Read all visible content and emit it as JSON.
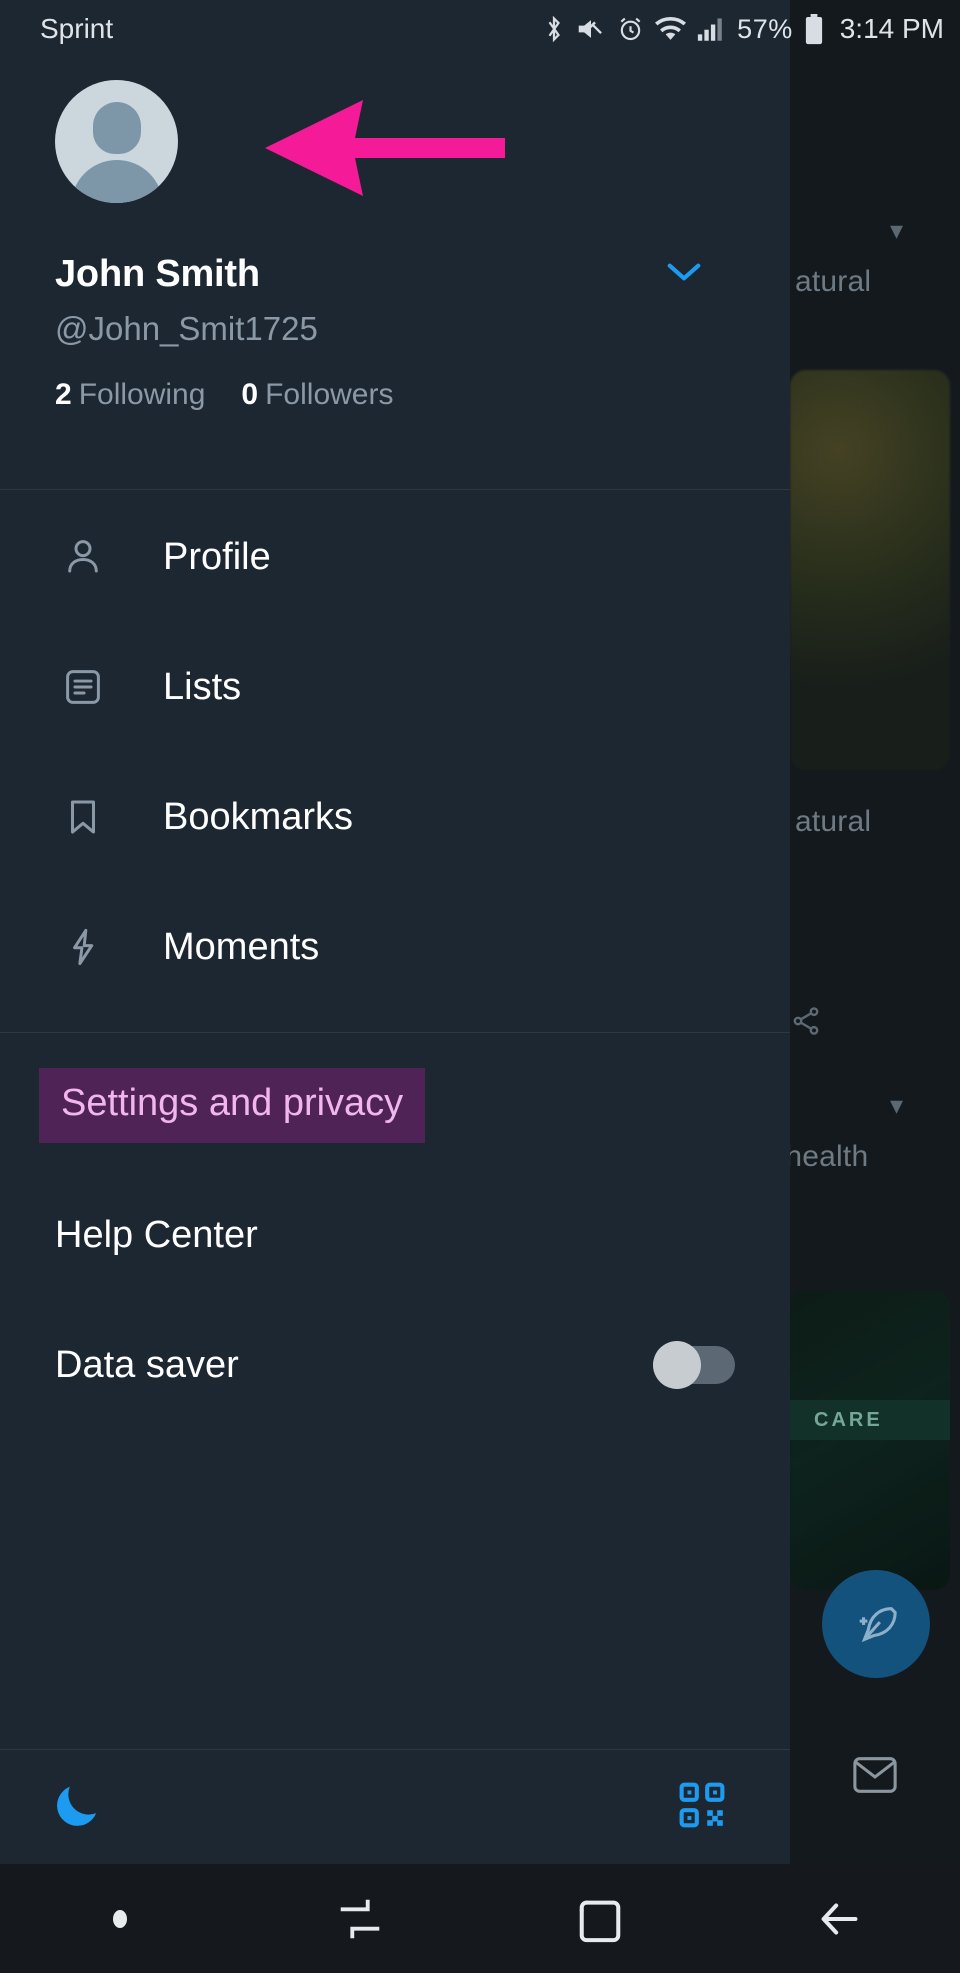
{
  "status_bar": {
    "carrier": "Sprint",
    "icons": [
      "bluetooth-icon",
      "mute-icon",
      "alarm-icon",
      "wifi-icon",
      "cellular-signal-icon",
      "battery-icon"
    ],
    "battery_percent": "57%",
    "time": "3:14 PM"
  },
  "account": {
    "avatar_alt": "default-avatar",
    "full_name": "John Smith",
    "handle": "@John_Smit1725",
    "expand_icon": "chevron-down-icon",
    "following_count": "2",
    "following_label": "Following",
    "followers_count": "0",
    "followers_label": "Followers"
  },
  "menu": {
    "items": [
      {
        "label": "Profile",
        "icon": "person-icon"
      },
      {
        "label": "Lists",
        "icon": "list-icon"
      },
      {
        "label": "Bookmarks",
        "icon": "bookmark-icon"
      },
      {
        "label": "Moments",
        "icon": "lightning-bolt-icon"
      }
    ]
  },
  "secondary_menu": {
    "items": [
      {
        "label": "Settings and privacy",
        "selected": true
      },
      {
        "label": "Help Center",
        "selected": false
      },
      {
        "label": "Data saver",
        "selected": false,
        "toggle": "off"
      }
    ]
  },
  "drawer_footer": {
    "night_mode_icon": "moon-icon",
    "qr_icon": "qr-code-icon"
  },
  "background": {
    "topic_1": "atural",
    "topic_2": "atural",
    "topic_3": "l health",
    "care_badge": "CARE",
    "share_icon": "share-icon",
    "compose_icon": "feather-compose-icon",
    "messages_icon": "envelope-icon",
    "chevron_icon": "chevron-down-icon"
  },
  "nav_bar": {
    "items": [
      {
        "icon": "dot-indicator-icon"
      },
      {
        "icon": "recents-switch-icon"
      },
      {
        "icon": "home-square-icon"
      },
      {
        "icon": "back-arrow-icon"
      }
    ]
  },
  "colors": {
    "drawer_bg": "#1c2732",
    "app_bg": "#14191d",
    "accent_blue": "#1d9bf0",
    "highlight_purple": "#4f2356",
    "highlight_text": "#f2b6ef",
    "annotation_pink": "#f51a97",
    "muted_text": "#8b99a6"
  }
}
